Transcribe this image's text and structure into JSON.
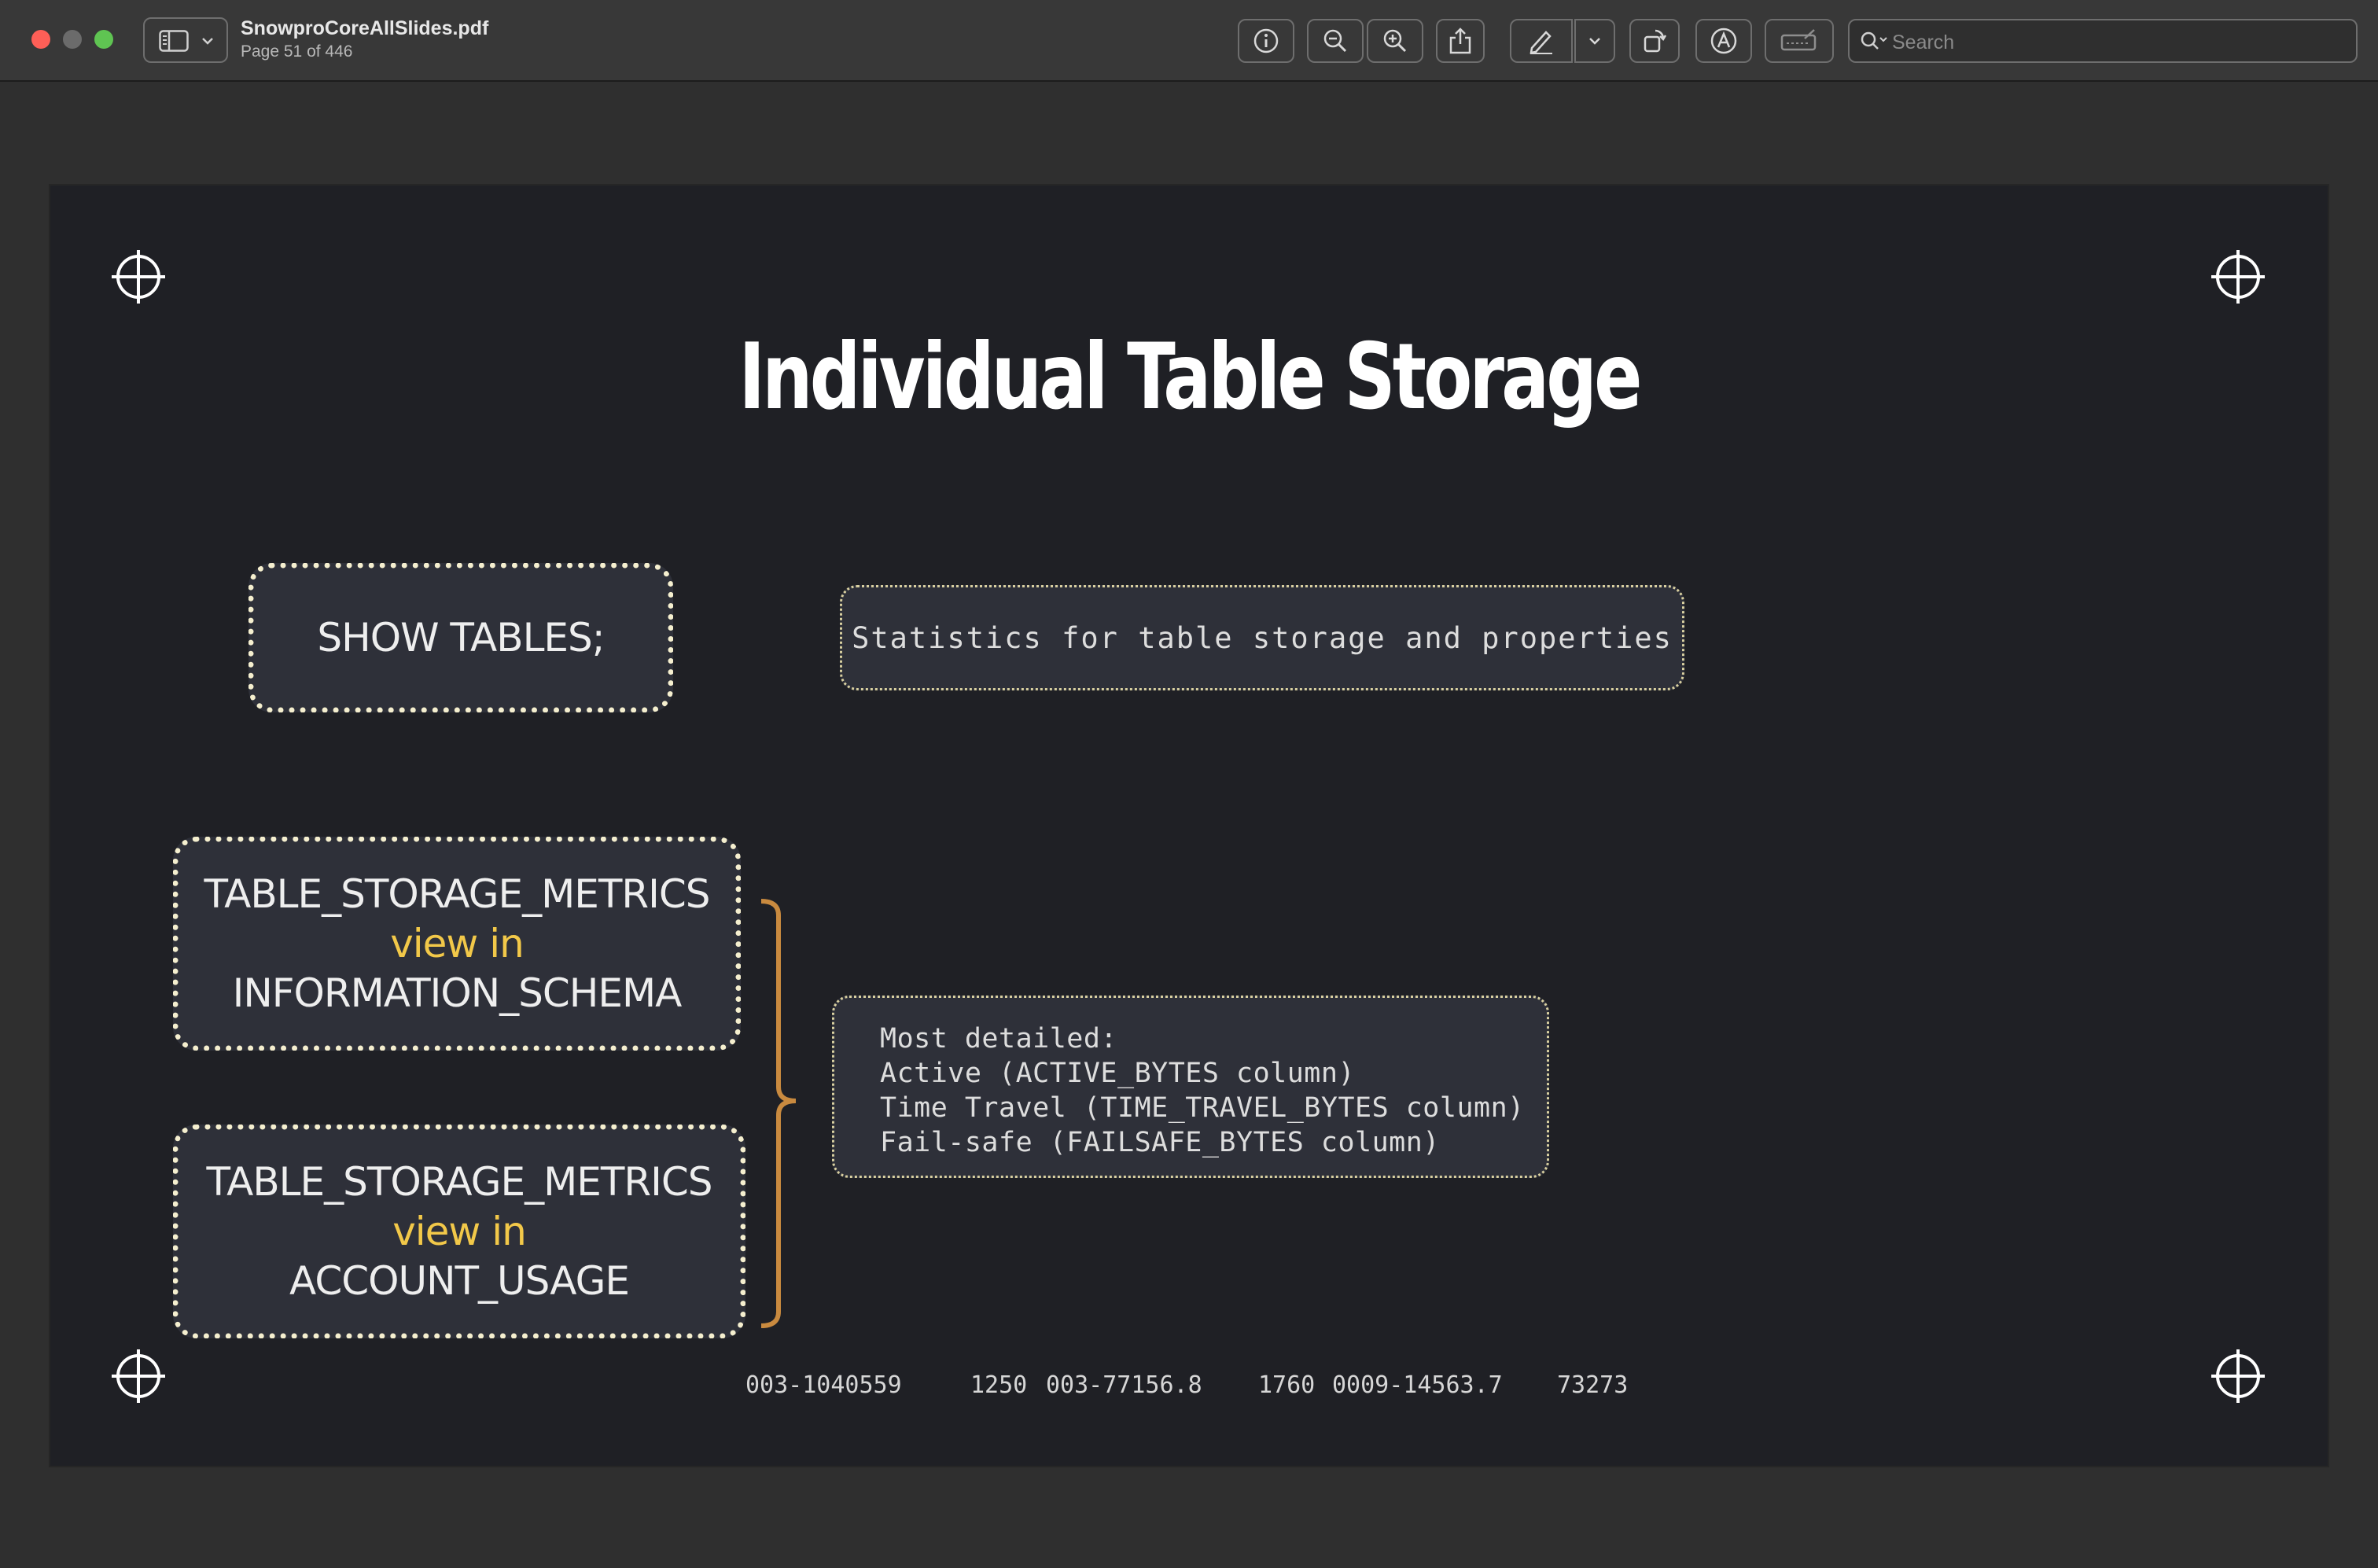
{
  "window": {
    "title": "SnowproCoreAllSlides.pdf",
    "subtitle": "Page 51 of 446"
  },
  "toolbar": {
    "search_placeholder": "Search",
    "icons": [
      "sidebar-icon",
      "info-icon",
      "zoom-out-icon",
      "zoom-in-icon",
      "share-icon",
      "markup-pen-icon",
      "chevron-down-icon",
      "rotate-icon",
      "annotate-icon",
      "signature-icon",
      "search-icon"
    ]
  },
  "slide": {
    "title": "Individual Table Storage",
    "show_tables": "SHOW TABLES;",
    "stat_note": "Statistics for table storage and properties",
    "box_info_schema": {
      "line1": "TABLE_STORAGE_METRICS",
      "line2": "view in",
      "line3": "INFORMATION_SCHEMA"
    },
    "box_account_usage": {
      "line1": "TABLE_STORAGE_METRICS",
      "line2": "view in",
      "line3": "ACCOUNT_USAGE"
    },
    "detail_lines": [
      "Most detailed:",
      "Active (ACTIVE_BYTES column)",
      "Time Travel (TIME_TRAVEL_BYTES column)",
      "Fail-safe (FAILSAFE_BYTES column)"
    ],
    "footer_codes": [
      "003-1040559",
      "1250",
      "003-77156.8",
      "1760",
      "0009-14563.7",
      "73273"
    ]
  },
  "colors": {
    "slide_bg": "#1f2025",
    "box_bg": "#2e3039",
    "accent_yellow": "#f2c849",
    "bracket": "#c98a3f",
    "dotted_border": "#f5efcf"
  }
}
